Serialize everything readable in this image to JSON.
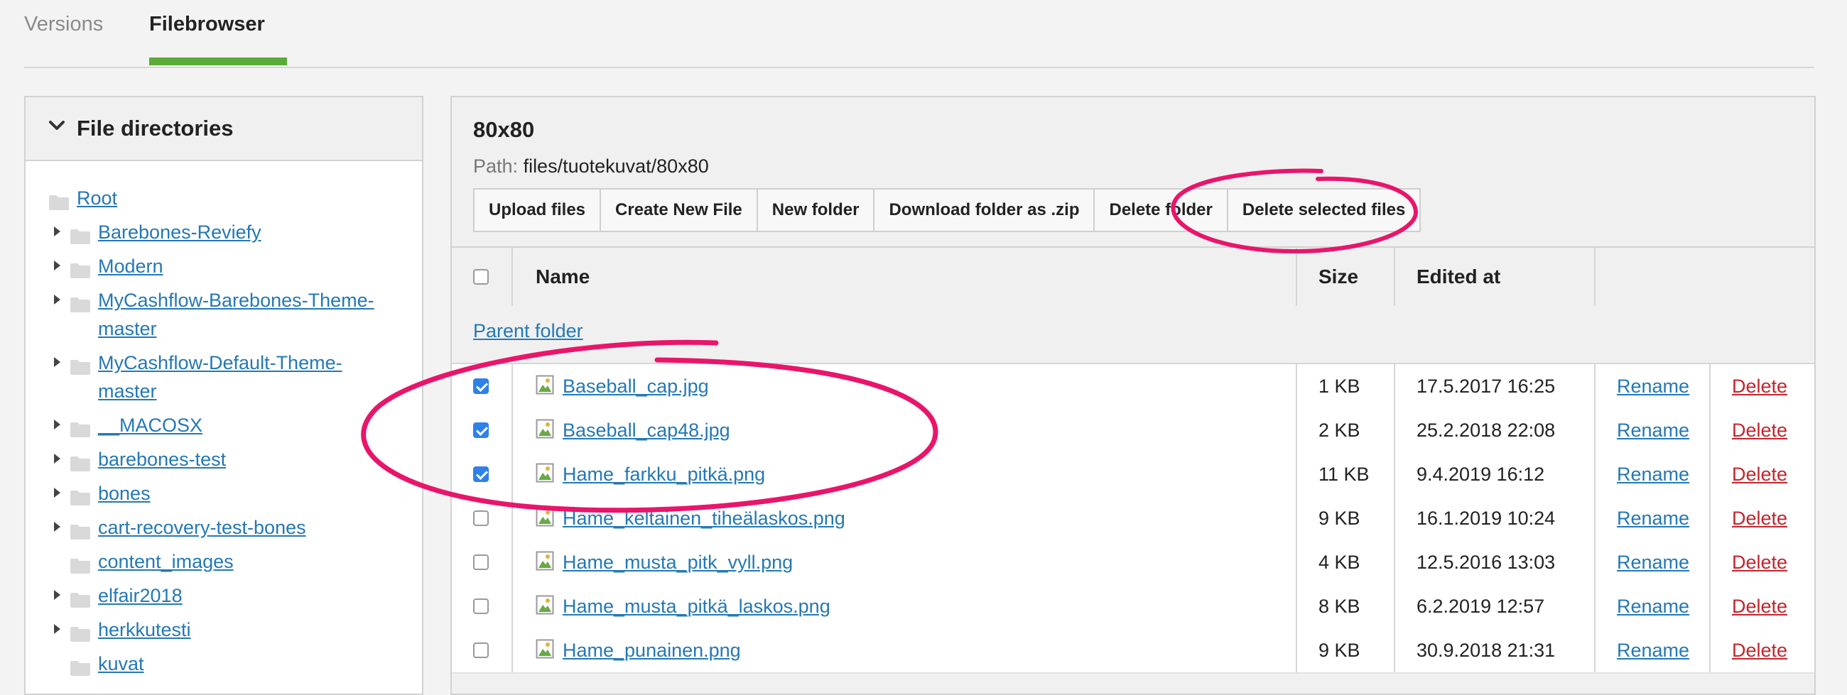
{
  "tabs": [
    {
      "label": "Versions",
      "active": false
    },
    {
      "label": "Filebrowser",
      "active": true
    }
  ],
  "sidebar": {
    "title": "File directories",
    "items": [
      {
        "label": "Root",
        "has_children": false
      },
      {
        "label": "Barebones-Reviefy",
        "has_children": true
      },
      {
        "label": "Modern",
        "has_children": true
      },
      {
        "label": "MyCashflow-Barebones-Theme-",
        "label2": "master",
        "has_children": true
      },
      {
        "label": "MyCashflow-Default-Theme-",
        "label2": "master",
        "has_children": true
      },
      {
        "label": "__MACOSX",
        "has_children": true
      },
      {
        "label": "barebones-test",
        "has_children": true
      },
      {
        "label": "bones",
        "has_children": true
      },
      {
        "label": "cart-recovery-test-bones",
        "has_children": true
      },
      {
        "label": "content_images",
        "has_children": false
      },
      {
        "label": "elfair2018",
        "has_children": true
      },
      {
        "label": "herkkutesti",
        "has_children": true
      },
      {
        "label": "kuvat",
        "has_children": false
      }
    ]
  },
  "main": {
    "folder_title": "80x80",
    "path_label": "Path:",
    "path_value": "files/tuotekuvat/80x80",
    "buttons": [
      "Upload files",
      "Create New File",
      "New folder",
      "Download folder as .zip",
      "Delete folder",
      "Delete selected files"
    ],
    "columns": {
      "name": "Name",
      "size": "Size",
      "edited": "Edited at"
    },
    "parent_folder": "Parent folder",
    "actions": {
      "rename": "Rename",
      "delete": "Delete"
    },
    "files": [
      {
        "name": "Baseball_cap.jpg",
        "size": "1 KB",
        "edited": "17.5.2017 16:25",
        "checked": true
      },
      {
        "name": "Baseball_cap48.jpg",
        "size": "2 KB",
        "edited": "25.2.2018 22:08",
        "checked": true
      },
      {
        "name": "Hame_farkku_pitkä.png",
        "size": "11 KB",
        "edited": "9.4.2019 16:12",
        "checked": true
      },
      {
        "name": "Hame_keltainen_tiheälaskos.png",
        "size": "9 KB",
        "edited": "16.1.2019 10:24",
        "checked": false
      },
      {
        "name": "Hame_musta_pitk_vyll.png",
        "size": "4 KB",
        "edited": "12.5.2016 13:03",
        "checked": false
      },
      {
        "name": "Hame_musta_pitkä_laskos.png",
        "size": "8 KB",
        "edited": "6.2.2019 12:57",
        "checked": false
      },
      {
        "name": "Hame_punainen.png",
        "size": "9 KB",
        "edited": "30.9.2018 21:31",
        "checked": false
      }
    ]
  },
  "colors": {
    "accent_green": "#5aab36",
    "link_blue": "#2478b5",
    "delete_red": "#c0262d",
    "annotation_pink": "#e8156b"
  },
  "icons": {
    "folder": "folder-icon",
    "image_file": "image-file-icon",
    "chevron": "chevron-down-icon"
  }
}
